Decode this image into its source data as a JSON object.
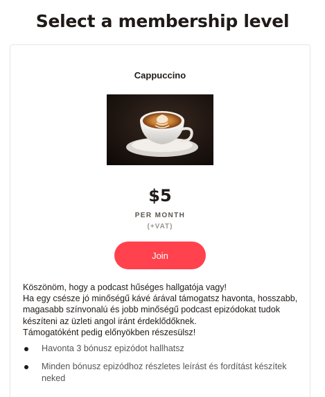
{
  "page": {
    "title": "Select a membership level"
  },
  "tier": {
    "name": "Cappuccino",
    "image_alt": "cappuccino-latte-art-photo",
    "price": "$5",
    "period": "PER MONTH",
    "tax_note": "(+VAT)",
    "join_label": "Join",
    "description": [
      "Köszönöm, hogy a podcast hűséges hallgatója vagy!",
      "Ha egy csésze jó minőségű kávé árával támogatsz havonta, hosszabb, magasabb színvonalú és jobb minőségű podcast epizódokat tudok készíteni az üzleti angol iránt érdeklődőknek.",
      "Támogatóként pedig előnyökben részesülsz!"
    ],
    "benefits": [
      "Havonta 3 bónusz epizódot hallhatsz",
      "Minden bónusz epizódhoz részletes leírást és fordítást készítek neked"
    ]
  },
  "colors": {
    "accent": "#ff424d",
    "text": "#1f1a17",
    "muted": "#545454"
  }
}
